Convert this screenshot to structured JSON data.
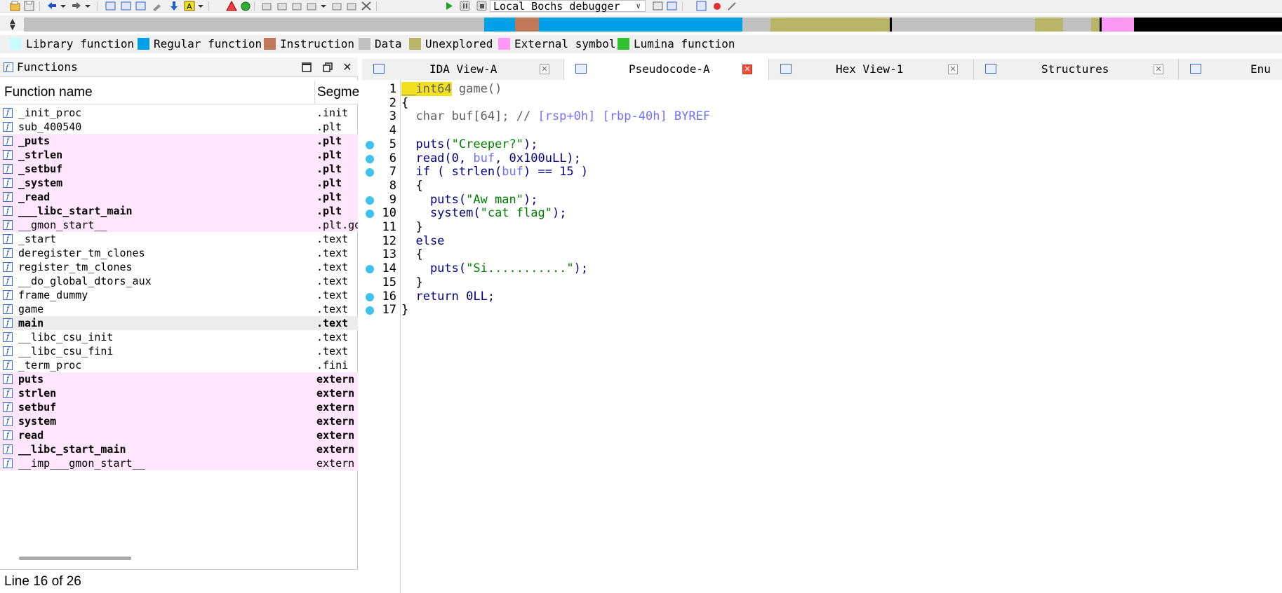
{
  "toolbar": {
    "debugger_select": "Local Bochs debugger"
  },
  "legend": [
    {
      "label": "Library function",
      "color": "#c8fcfc"
    },
    {
      "label": "Regular function",
      "color": "#00a0e8"
    },
    {
      "label": "Instruction",
      "color": "#c07858"
    },
    {
      "label": "Data",
      "color": "#c0c0c0"
    },
    {
      "label": "Unexplored",
      "color": "#b8b468"
    },
    {
      "label": "External symbol",
      "color": "#ff98f4"
    },
    {
      "label": "Lumina function",
      "color": "#30c030"
    }
  ],
  "functions_panel": {
    "title": "Functions",
    "col_name": "Function name",
    "col_segment": "Segme",
    "rows": [
      {
        "name": "_init_proc",
        "segment": ".init",
        "style": "normal"
      },
      {
        "name": "sub_400540",
        "segment": ".plt",
        "style": "normal"
      },
      {
        "name": "_puts",
        "segment": ".plt",
        "style": "pink-bold"
      },
      {
        "name": "_strlen",
        "segment": ".plt",
        "style": "pink-bold"
      },
      {
        "name": "_setbuf",
        "segment": ".plt",
        "style": "pink-bold"
      },
      {
        "name": "_system",
        "segment": ".plt",
        "style": "pink-bold"
      },
      {
        "name": "_read",
        "segment": ".plt",
        "style": "pink-bold"
      },
      {
        "name": "___libc_start_main",
        "segment": ".plt",
        "style": "pink-bold"
      },
      {
        "name": "__gmon_start__",
        "segment": ".plt.go",
        "style": "pink"
      },
      {
        "name": "_start",
        "segment": ".text",
        "style": "normal"
      },
      {
        "name": "deregister_tm_clones",
        "segment": ".text",
        "style": "normal"
      },
      {
        "name": "register_tm_clones",
        "segment": ".text",
        "style": "normal"
      },
      {
        "name": "__do_global_dtors_aux",
        "segment": ".text",
        "style": "normal"
      },
      {
        "name": "frame_dummy",
        "segment": ".text",
        "style": "normal"
      },
      {
        "name": "game",
        "segment": ".text",
        "style": "normal"
      },
      {
        "name": "main",
        "segment": ".text",
        "style": "sel-bold"
      },
      {
        "name": "__libc_csu_init",
        "segment": ".text",
        "style": "normal"
      },
      {
        "name": "__libc_csu_fini",
        "segment": ".text",
        "style": "normal"
      },
      {
        "name": "_term_proc",
        "segment": ".fini",
        "style": "normal"
      },
      {
        "name": "puts",
        "segment": "extern",
        "style": "pink-bold"
      },
      {
        "name": "strlen",
        "segment": "extern",
        "style": "pink-bold"
      },
      {
        "name": "setbuf",
        "segment": "extern",
        "style": "pink-bold"
      },
      {
        "name": "system",
        "segment": "extern",
        "style": "pink-bold"
      },
      {
        "name": "read",
        "segment": "extern",
        "style": "pink-bold"
      },
      {
        "name": "__libc_start_main",
        "segment": "extern",
        "style": "pink-bold"
      },
      {
        "name": "__imp___gmon_start__",
        "segment": "extern",
        "style": "pink"
      }
    ],
    "status": "Line 16 of 26"
  },
  "tabs": [
    {
      "label": "IDA View-A",
      "active": false
    },
    {
      "label": "Pseudocode-A",
      "active": true
    },
    {
      "label": "Hex View-1",
      "active": false
    },
    {
      "label": "Structures",
      "active": false
    },
    {
      "label": "Enu",
      "active": false
    }
  ],
  "code": {
    "lines": [
      {
        "n": "1",
        "dot": false
      },
      {
        "n": "2",
        "dot": false
      },
      {
        "n": "3",
        "dot": false
      },
      {
        "n": "4",
        "dot": false
      },
      {
        "n": "5",
        "dot": true
      },
      {
        "n": "6",
        "dot": true
      },
      {
        "n": "7",
        "dot": true
      },
      {
        "n": "8",
        "dot": false
      },
      {
        "n": "9",
        "dot": true
      },
      {
        "n": "10",
        "dot": true
      },
      {
        "n": "11",
        "dot": false
      },
      {
        "n": "12",
        "dot": false
      },
      {
        "n": "13",
        "dot": false
      },
      {
        "n": "14",
        "dot": true
      },
      {
        "n": "15",
        "dot": false
      },
      {
        "n": "16",
        "dot": true
      },
      {
        "n": "17",
        "dot": true
      }
    ],
    "tokens": {
      "l1_type": "__int64",
      "l1_rest": " game()",
      "l2": "{",
      "l3_a": "  char buf[64]; // ",
      "l3_cmt": "[rsp+0h] [rbp-40h] BYREF",
      "l5_a": "  puts(",
      "l5_str": "\"Creeper?\"",
      "l5_b": ");",
      "l6_a": "  read(0, ",
      "l6_var": "buf",
      "l6_b": ", 0x100uLL);",
      "l7_a": "  if ( strlen(",
      "l7_var": "buf",
      "l7_b": ") == 15 )",
      "l8": "  {",
      "l9_a": "    puts(",
      "l9_str": "\"Aw man\"",
      "l9_b": ");",
      "l10_a": "    system(",
      "l10_str": "\"cat flag\"",
      "l10_b": ");",
      "l11": "  }",
      "l12": "  else",
      "l13": "  {",
      "l14_a": "    puts(",
      "l14_str": "\"Si...........\"",
      "l14_b": ");",
      "l15": "  }",
      "l16": "  return 0LL;",
      "l17": "}"
    }
  }
}
